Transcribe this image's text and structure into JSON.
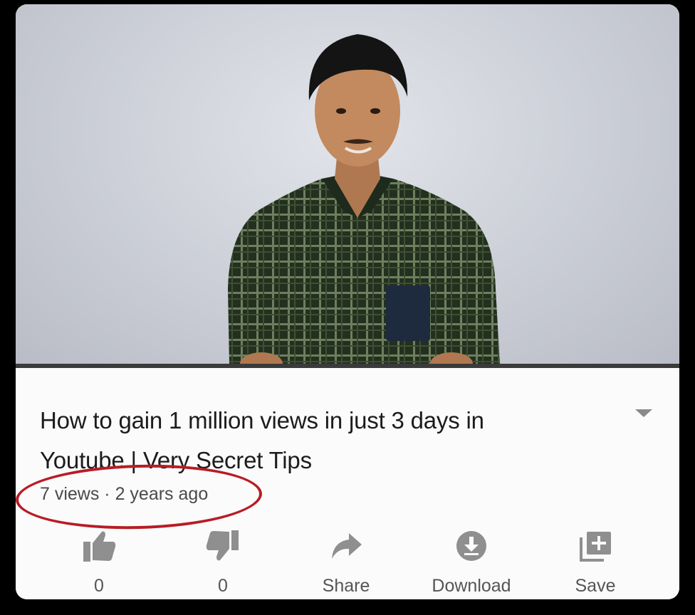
{
  "video": {
    "title_line1": "How to gain 1 million views in just 3 days in",
    "title_line2": "Youtube | Very Secret Tips",
    "meta": "7 views · 2 years ago"
  },
  "actions": {
    "like_count": "0",
    "dislike_count": "0",
    "share_label": "Share",
    "download_label": "Download",
    "save_label": "Save"
  },
  "icons": {
    "like": "thumbs-up-icon",
    "dislike": "thumbs-down-icon",
    "share": "share-arrow-icon",
    "download": "download-icon",
    "save": "playlist-add-icon",
    "expand": "chevron-down-icon"
  },
  "colors": {
    "annotation_circle": "#b81c25",
    "icon_gray": "#8f8f8f",
    "text_dark": "#1c1c1c"
  }
}
